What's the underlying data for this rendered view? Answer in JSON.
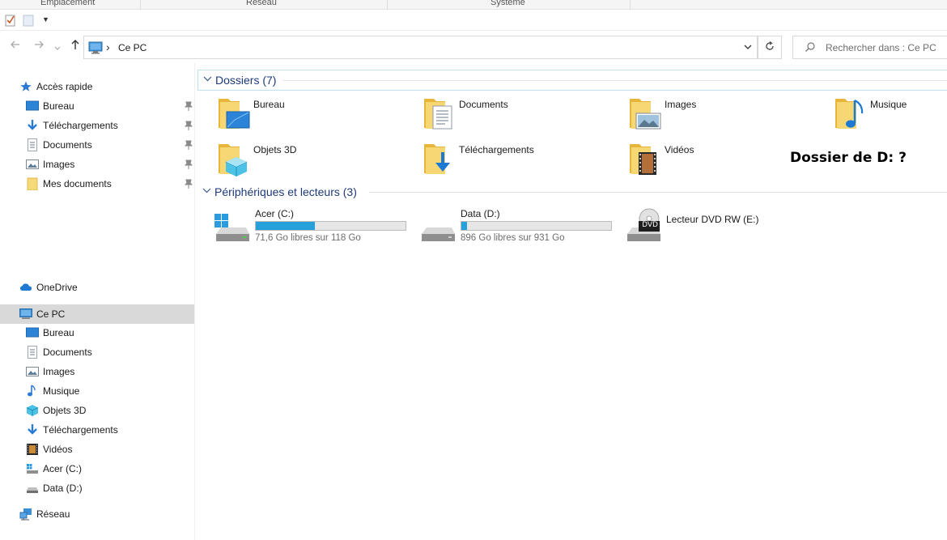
{
  "ribbon": {
    "groups": [
      "Emplacement",
      "Réseau",
      "Système"
    ]
  },
  "navigation": {
    "back_icon": "arrow-left-icon",
    "forward_icon": "arrow-right-icon",
    "recent_icon": "chevron-down-icon",
    "up_icon": "arrow-up-icon"
  },
  "address_bar": {
    "path": [
      "Ce PC"
    ],
    "current": "Ce PC"
  },
  "search": {
    "placeholder": "Rechercher dans : Ce PC"
  },
  "sidebar": {
    "quick_access": {
      "label": "Accès rapide",
      "items": [
        {
          "label": "Bureau",
          "icon": "desktop-icon",
          "pinned": true
        },
        {
          "label": "Téléchargements",
          "icon": "downloads-icon",
          "pinned": true
        },
        {
          "label": "Documents",
          "icon": "documents-icon",
          "pinned": true
        },
        {
          "label": "Images",
          "icon": "pictures-icon",
          "pinned": true
        },
        {
          "label": "Mes documents",
          "icon": "folder-icon",
          "pinned": true
        }
      ]
    },
    "onedrive": {
      "label": "OneDrive"
    },
    "this_pc": {
      "label": "Ce PC",
      "items": [
        {
          "label": "Bureau",
          "icon": "desktop-icon"
        },
        {
          "label": "Documents",
          "icon": "documents-icon"
        },
        {
          "label": "Images",
          "icon": "pictures-icon"
        },
        {
          "label": "Musique",
          "icon": "music-icon"
        },
        {
          "label": "Objets 3D",
          "icon": "3d-objects-icon"
        },
        {
          "label": "Téléchargements",
          "icon": "downloads-icon"
        },
        {
          "label": "Vidéos",
          "icon": "videos-icon"
        },
        {
          "label": "Acer (C:)",
          "icon": "drive-c-icon"
        },
        {
          "label": "Data (D:)",
          "icon": "drive-d-icon"
        }
      ]
    },
    "network": {
      "label": "Réseau"
    }
  },
  "folders_group": {
    "title": "Dossiers (7)",
    "items": [
      {
        "label": "Bureau",
        "icon": "desktop-folder-icon"
      },
      {
        "label": "Documents",
        "icon": "documents-folder-icon"
      },
      {
        "label": "Images",
        "icon": "pictures-folder-icon"
      },
      {
        "label": "Musique",
        "icon": "music-folder-icon"
      },
      {
        "label": "Objets 3D",
        "icon": "3d-objects-folder-icon"
      },
      {
        "label": "Téléchargements",
        "icon": "downloads-folder-icon"
      },
      {
        "label": "Vidéos",
        "icon": "videos-folder-icon"
      }
    ]
  },
  "drives_group": {
    "title": "Périphériques et lecteurs (3)",
    "items": [
      {
        "label": "Acer (C:)",
        "free_text": "71,6 Go libres sur 118 Go",
        "used_fraction": 0.393,
        "icon": "windows-drive-icon"
      },
      {
        "label": "Data (D:)",
        "free_text": "896 Go libres sur 931 Go",
        "used_fraction": 0.038,
        "icon": "hard-drive-icon"
      },
      {
        "label": "Lecteur DVD RW (E:)",
        "icon": "dvd-drive-icon",
        "badge": "DVD"
      }
    ]
  },
  "annotation": {
    "text": "Dossier de D: ?"
  },
  "colors": {
    "accent": "#26a0da",
    "folder": "#f3c94f",
    "selected": "#d9d9d9",
    "group_title": "#1e3a7a"
  }
}
